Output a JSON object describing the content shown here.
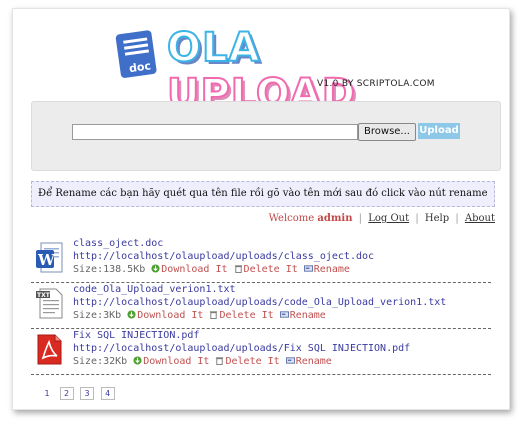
{
  "logo": {
    "icon_text": "doc",
    "word1": "OLA",
    "word2": "UPLOAD",
    "tagline": "V1.0 BY SCRIPTOLA.COM"
  },
  "upload": {
    "browse_label": "Browse...",
    "upload_label": "Upload"
  },
  "notice": "Để Rename các bạn hãy quét qua tên file rồi gõ vào tên mới sau đó click vào nút rename",
  "userbar": {
    "welcome": "Welcome",
    "username": "admin",
    "logout": "Log Out",
    "help": "Help",
    "about": "About"
  },
  "files": [
    {
      "name": "class_oject.doc",
      "url": "http://localhost/olaupload/uploads/class_oject.doc",
      "size": "Size:138.5Kb",
      "icon": "word-doc-icon"
    },
    {
      "name": "code_Ola_Upload_verion1.txt",
      "url": "http://localhost/olaupload/uploads/code_Ola_Upload_verion1.txt",
      "size": "Size:3Kb",
      "icon": "txt-file-icon"
    },
    {
      "name": "Fix SQL INJECTION.pdf",
      "url": "http://localhost/olaupload/uploads/Fix SQL INJECTION.pdf",
      "size": "Size:32Kb",
      "icon": "pdf-file-icon"
    }
  ],
  "actions": {
    "download": "Download It",
    "delete": "Delete It",
    "rename": "Rename"
  },
  "pager": [
    "1",
    "2",
    "3",
    "4"
  ]
}
